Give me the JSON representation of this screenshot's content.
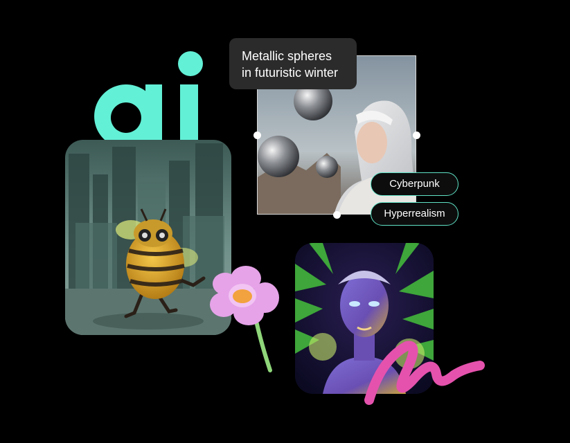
{
  "logo": {
    "text": "ai",
    "color": "#62f0d6"
  },
  "prompt": {
    "line1": "Metallic spheres",
    "line2": "in futuristic winter"
  },
  "tags": [
    {
      "label": "Cyberpunk"
    },
    {
      "label": "Hyperrealism"
    }
  ],
  "colors": {
    "accent": "#5fe3c6",
    "squiggle": "#e552ad",
    "flower": "#e6a3e8",
    "background": "#000000"
  },
  "icons": {
    "bee": "robot-bee-illustration",
    "flower": "flower-3d-icon",
    "squiggle": "brush-squiggle"
  }
}
